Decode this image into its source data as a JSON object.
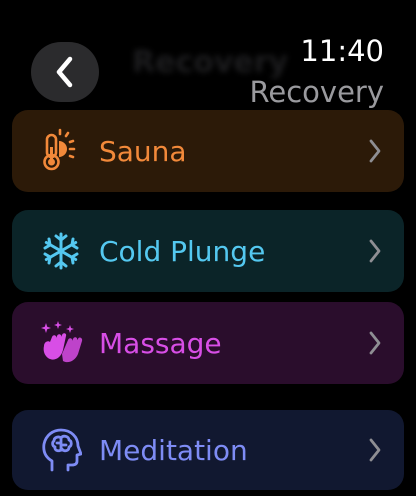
{
  "header": {
    "time": "11:40",
    "title": "Recovery",
    "ghost_title": "Recovery"
  },
  "items": [
    {
      "label": "Sauna",
      "icon": "thermometer-sun-icon",
      "color": "#f2893a"
    },
    {
      "label": "Cold Plunge",
      "icon": "snowflake-icon",
      "color": "#54c8f0"
    },
    {
      "label": "Massage",
      "icon": "hands-sparkles-icon",
      "color": "#d84ee6"
    },
    {
      "label": "Meditation",
      "icon": "head-brain-icon",
      "color": "#7e8cf5"
    }
  ],
  "chevron_color": "#8e8e93"
}
